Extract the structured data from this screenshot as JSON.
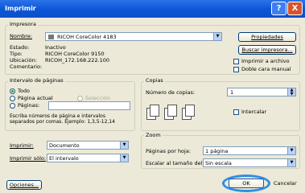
{
  "window": {
    "title": "Imprimir",
    "help": "?",
    "close": "X"
  },
  "printer": {
    "legend": "Impresora",
    "name_label": "Nombre:",
    "name_value": "RICOH CoreColor 4183",
    "properties_button": "Propiedades",
    "status_label": "Estado:",
    "status_value": "Inactivo",
    "type_label": "Tipo:",
    "type_value": "RICOH CoreColor 9150",
    "location_label": "Ubicación:",
    "location_value": "RICOH_172.168.222.100",
    "comment_label": "Comentario:",
    "find_button": "Buscar impresora...",
    "print_to_file": "Imprimir a archivo",
    "manual_duplex": "Doble cara manual"
  },
  "page_range": {
    "legend": "Intervalo de páginas",
    "all": "Todo",
    "current": "Página actual",
    "selection": "Selección",
    "pages": "Páginas:",
    "hint": "Escriba números de página e intervalos separados por comas. Ejemplo: 1,3,5-12,14"
  },
  "copies": {
    "legend": "Copias",
    "count_label": "Número de copias:",
    "count_value": "1",
    "collate": "Intercalar"
  },
  "print_what": {
    "label": "Imprimir:",
    "value": "Documento"
  },
  "print_only": {
    "label": "Imprimir sólo:",
    "value": "El intervalo"
  },
  "zoom": {
    "legend": "Zoom",
    "pages_per_sheet_label": "Páginas por hoja:",
    "pages_per_sheet_value": "1 página",
    "scale_label": "Escalar al tamaño del papel:",
    "scale_value": "Sin escala"
  },
  "footer": {
    "options": "Opciones...",
    "ok": "OK",
    "cancel": "Cancelar"
  }
}
